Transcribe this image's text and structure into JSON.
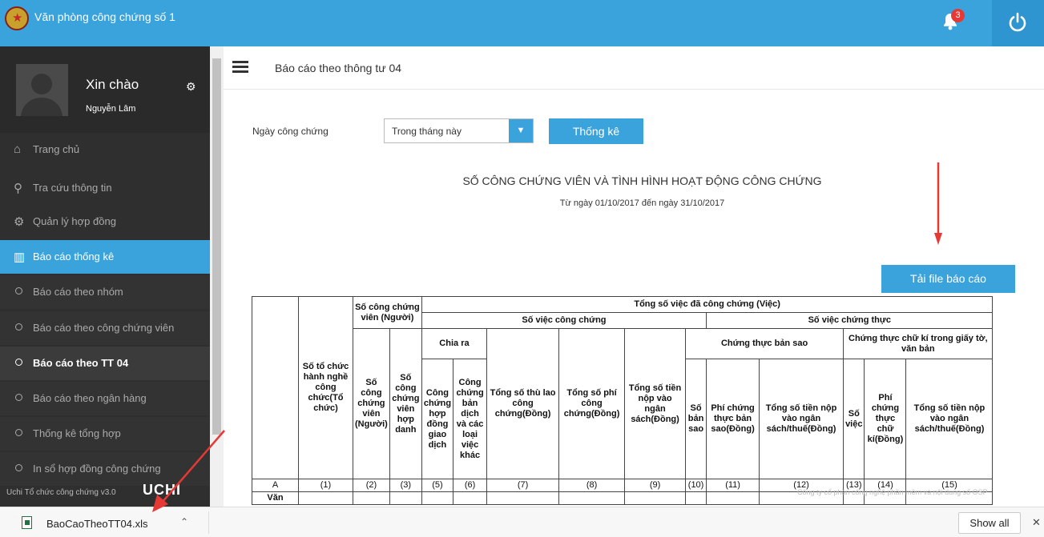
{
  "app": {
    "title": "Văn phòng công chứng số 1",
    "notification_count": "3"
  },
  "user": {
    "greeting": "Xin chào",
    "name": "Nguyễn Lâm"
  },
  "menu": {
    "items": [
      {
        "label": "Trang chủ",
        "icon": "home-icon"
      },
      {
        "label": "Tra cứu thông tin",
        "icon": "search-icon"
      },
      {
        "label": "Quản lý hợp đồng",
        "icon": "gear-icon"
      },
      {
        "label": "Báo cáo thống kê",
        "icon": "chart-icon"
      }
    ],
    "sub": [
      "Báo cáo theo nhóm",
      "Báo cáo theo công chứng viên",
      "Báo cáo theo TT 04",
      "Báo cáo theo ngân hàng",
      "Thống kê tổng hợp",
      "In sổ hợp đồng công chứng"
    ],
    "footer": "Uchi Tổ chức công chứng v3.0",
    "footer_logo": "UCHI"
  },
  "header": {
    "title": "Báo cáo theo thông tư 04"
  },
  "filter": {
    "label": "Ngày công chứng",
    "selected": "Trong tháng này",
    "submit": "Thống kê"
  },
  "report": {
    "title": "SỐ CÔNG CHỨNG VIÊN VÀ TÌNH HÌNH HOẠT ĐỘNG CÔNG CHỨNG",
    "range": "Từ ngày 01/10/2017 đến ngày 31/10/2017",
    "download": "Tải file báo cáo"
  },
  "table": {
    "h_to_chuc": "Số tổ chức hành nghề công chức(Tổ chức)",
    "h_so_ccv": "Số công chứng viên (Người)",
    "h_tong_viec": "Tổng số việc đã công chứng (Việc)",
    "h_viec_cc": "Số việc công chứng",
    "h_viec_ct": "Số việc chứng thực",
    "h_chia_ra": "Chia ra",
    "h_ct_ban_sao": "Chứng thực bản sao",
    "h_ct_chu_ki": "Chứng thực chữ kí trong giấy tờ, văn bản",
    "c_tong_so": "Tổng số",
    "c_ccv_hop_danh": "Số công chứng viên hợp danh",
    "c_tong_so_viec": "Tổng số",
    "c_hop_dong": "Công chứng hợp đồng giao dịch",
    "c_ban_dich": "Công chứng bản dịch và các loại việc khác",
    "c_thu_lao": "Tổng số thù lao công chứng(Đồng)",
    "c_phi_cc": "Tổng số phí công chứng(Đồng)",
    "c_nop_ns": "Tổng số tiền nộp vào ngân sách(Đồng)",
    "c_so_ban_sao": "Số bản sao",
    "c_phi_ban_sao": "Phí chứng thực bản sao(Đồng)",
    "c_nop_ns_bs": "Tổng số tiền nộp vào ngân sách/thuế(Đồng)",
    "c_so_viec": "Số việc",
    "c_phi_chu_ki": "Phí chứng thực chữ kí(Đồng)",
    "c_nop_ns_ck": "Tổng số tiền nộp vào ngân sách/thuế(Đồng)",
    "index_row": [
      "A",
      "(1)",
      "(2)",
      "(3)",
      "(4)",
      "(5)",
      "(6)",
      "(7)",
      "(8)",
      "(9)",
      "(10)",
      "(11)",
      "(12)",
      "(13)",
      "(14)",
      "(15)"
    ],
    "first_cell": "Văn"
  },
  "watermark": "Công ty cổ phần công nghệ phần mềm và nội dung số OSP",
  "download_bar": {
    "file": "BaoCaoTheoTT04.xls",
    "show_all": "Show all",
    "close": "✕"
  }
}
